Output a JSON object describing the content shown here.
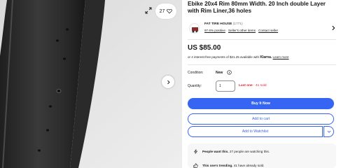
{
  "gallery": {
    "watch_count": "27",
    "icons": {
      "expand": "expand-icon",
      "watch": "heart-icon",
      "next": "chevron-right-icon"
    }
  },
  "listing": {
    "title": "Ebike 20x4 Rim 80mm Width. 20 Inch double Layer with Rim Liner,36 holes"
  },
  "seller": {
    "name": "FAT TIRE HOUSE",
    "feedback_count": "(1771)",
    "positive": "97.6% positive",
    "other_items": "Seller's other items",
    "contact": "Contact seller"
  },
  "price": {
    "amount": "US $85.00",
    "installments_text": "or 4 interest-free payments of $21.25 available with",
    "provider": "Klarna.",
    "learn_more": "Learn more"
  },
  "condition": {
    "label": "Condition:",
    "value": "New"
  },
  "quantity": {
    "label": "Quantity:",
    "value": "1",
    "last_one": "Last one",
    "sold": "41 sold"
  },
  "actions": {
    "buy_now": "Buy It Now",
    "add_to_cart": "Add to cart",
    "add_to_watchlist": "Add to Watchlist"
  },
  "promo": {
    "watching_bold": "People want this.",
    "watching_rest": "27 people are watching this.",
    "trending_bold": "This one's trending.",
    "trending_rest": "41 have already sold."
  },
  "colors": {
    "accent": "#3665f3",
    "alert": "#dd1e31",
    "text": "#191919",
    "muted": "#707070"
  }
}
